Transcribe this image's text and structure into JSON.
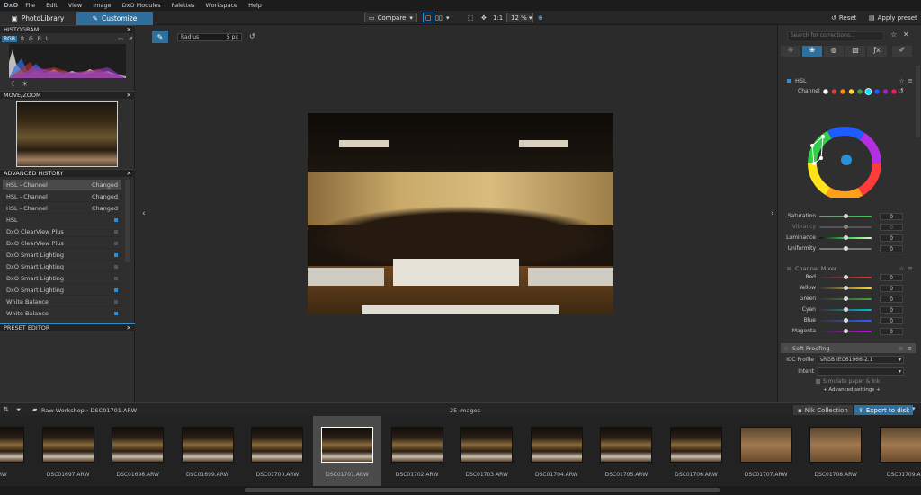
{
  "app": {
    "logo": "DxO"
  },
  "menu": [
    "File",
    "Edit",
    "View",
    "Image",
    "DxO Modules",
    "Palettes",
    "Workspace",
    "Help"
  ],
  "tabs": {
    "photolibrary": "PhotoLibrary",
    "customize": "Customize"
  },
  "toolbar": {
    "compare": "Compare",
    "one_to_one": "1:1",
    "zoom": "12 %",
    "reset": "Reset",
    "apply_preset": "Apply preset"
  },
  "histogram": {
    "title": "HISTOGRAM",
    "channels": [
      "RGB",
      "R",
      "G",
      "B",
      "L"
    ]
  },
  "movezoom": {
    "title": "MOVE/ZOOM"
  },
  "history": {
    "title": "ADVANCED HISTORY",
    "items": [
      {
        "label": "HSL - Channel",
        "status": "Changed"
      },
      {
        "label": "HSL - Channel",
        "status": "Changed"
      },
      {
        "label": "HSL - Channel",
        "status": "Changed"
      },
      {
        "label": "HSL",
        "status": ""
      },
      {
        "label": "DxO ClearView Plus",
        "status": ""
      },
      {
        "label": "DxO ClearView Plus",
        "status": ""
      },
      {
        "label": "DxO Smart Lighting",
        "status": ""
      },
      {
        "label": "DxO Smart Lighting",
        "status": ""
      },
      {
        "label": "DxO Smart Lighting",
        "status": ""
      },
      {
        "label": "DxO Smart Lighting",
        "status": ""
      },
      {
        "label": "White Balance",
        "status": ""
      },
      {
        "label": "White Balance",
        "status": ""
      }
    ]
  },
  "preset_editor": {
    "title": "PRESET EDITOR"
  },
  "radius": {
    "label": "Radius",
    "value": "5 px"
  },
  "search": {
    "placeholder": "Search for corrections..."
  },
  "hsl": {
    "title": "HSL",
    "channel_label": "Channel",
    "channel_colors": [
      "#ffffff",
      "#e53935",
      "#fb8c00",
      "#fdd835",
      "#43a047",
      "#00e5ff",
      "#1e5cff",
      "#9c27b0",
      "#e91e63"
    ],
    "sliders": [
      {
        "label": "Saturation",
        "value": "0"
      },
      {
        "label": "Vibrancy",
        "value": "0"
      },
      {
        "label": "Luminance",
        "value": "0"
      },
      {
        "label": "Uniformity",
        "value": "0"
      }
    ]
  },
  "mixer": {
    "title": "Channel Mixer",
    "rows": [
      {
        "label": "Red",
        "value": "0",
        "color": "#e53935"
      },
      {
        "label": "Yellow",
        "value": "0",
        "color": "#fdd835"
      },
      {
        "label": "Green",
        "value": "0",
        "color": "#43a047"
      },
      {
        "label": "Cyan",
        "value": "0",
        "color": "#00bcd4"
      },
      {
        "label": "Blue",
        "value": "0",
        "color": "#2962ff"
      },
      {
        "label": "Magenta",
        "value": "0",
        "color": "#d500f9"
      }
    ]
  },
  "softproof": {
    "title": "Soft Proofing",
    "icc_label": "ICC Profile",
    "icc_value": "sRGB IEC61966-2.1",
    "intent_label": "Intent",
    "simulate": "Simulate paper & ink",
    "advanced": "+ Advanced settings +"
  },
  "filmstrip": {
    "path": "Raw Workshop › DSC01701.ARW",
    "count": "25 images",
    "nik": "Nik Collection",
    "export": "Export to disk",
    "thumbs": [
      "6.ARW",
      "DSC01697.ARW",
      "DSC01698.ARW",
      "DSC01699.ARW",
      "DSC01700.ARW",
      "DSC01701.ARW",
      "DSC01702.ARW",
      "DSC01703.ARW",
      "DSC01704.ARW",
      "DSC01705.ARW",
      "DSC01706.ARW",
      "DSC01707.ARW",
      "DSC01708.ARW",
      "DSC01709.AR"
    ]
  }
}
